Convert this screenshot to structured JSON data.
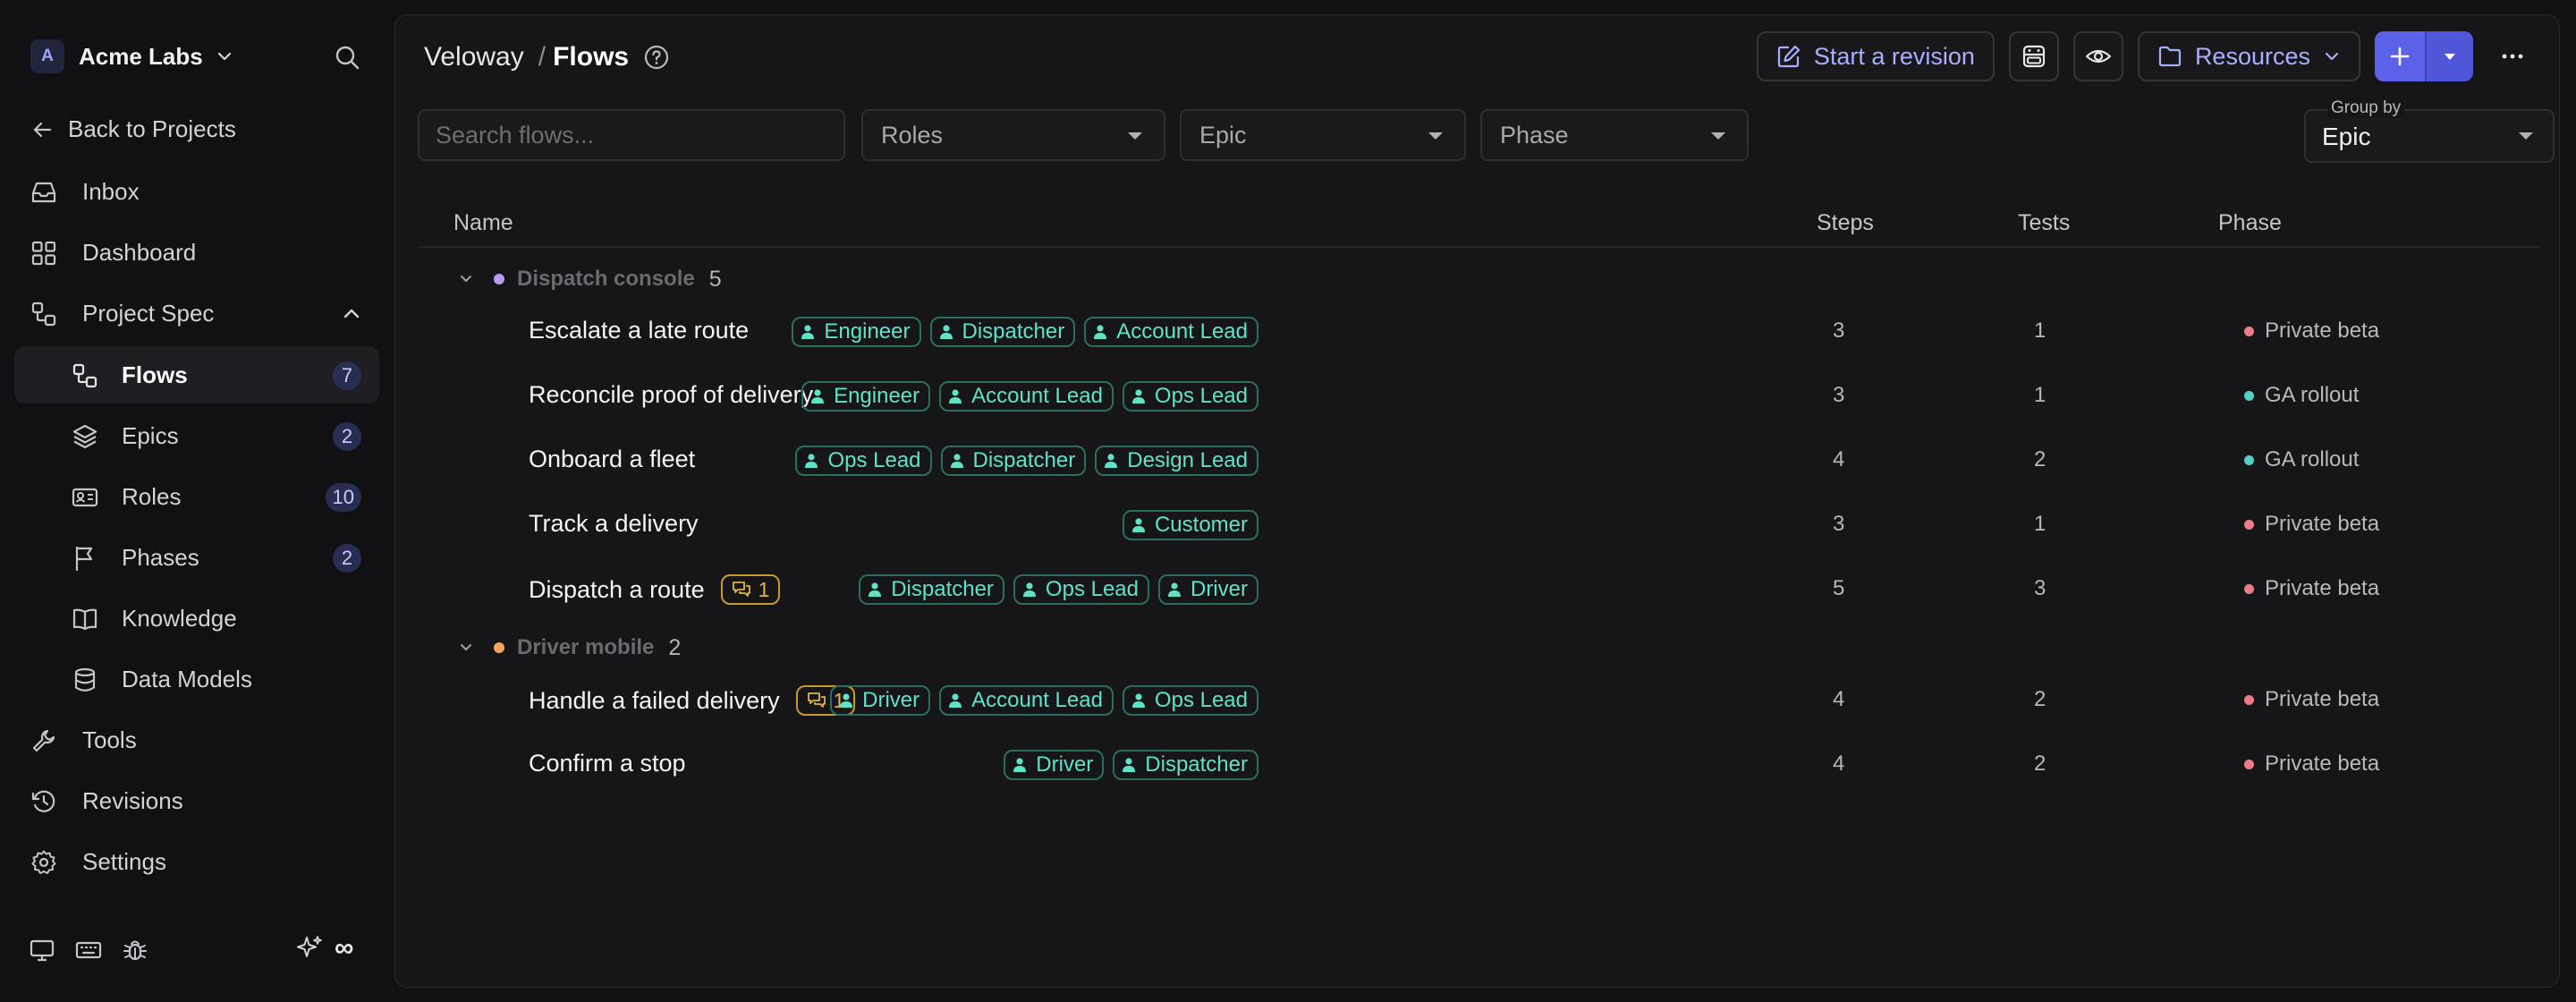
{
  "workspace": {
    "initial": "A",
    "name": "Acme Labs"
  },
  "sidebar": {
    "back": "Back to Projects",
    "items": [
      {
        "label": "Inbox"
      },
      {
        "label": "Dashboard"
      },
      {
        "label": "Project Spec"
      },
      {
        "label": "Flows",
        "count": "7"
      },
      {
        "label": "Epics",
        "count": "2"
      },
      {
        "label": "Roles",
        "count": "10"
      },
      {
        "label": "Phases",
        "count": "2"
      },
      {
        "label": "Knowledge"
      },
      {
        "label": "Data Models"
      },
      {
        "label": "Tools"
      },
      {
        "label": "Revisions"
      },
      {
        "label": "Settings"
      }
    ],
    "footer_infinity": "∞"
  },
  "header": {
    "project": "Veloway",
    "separator": "/",
    "page": "Flows",
    "start_revision": "Start a revision",
    "resources": "Resources"
  },
  "filters": {
    "search_placeholder": "Search flows...",
    "roles": "Roles",
    "epic": "Epic",
    "phase": "Phase",
    "group_by_label": "Group by",
    "group_by_value": "Epic"
  },
  "table": {
    "columns": {
      "name": "Name",
      "steps": "Steps",
      "tests": "Tests",
      "phase": "Phase"
    },
    "groups": [
      {
        "name": "Dispatch console",
        "count": "5",
        "dot_color": "#b79cf2",
        "rows": [
          {
            "name": "Escalate a late route",
            "roles": [
              "Engineer",
              "Dispatcher",
              "Account Lead"
            ],
            "steps": "3",
            "tests": "1",
            "phase": "Private beta",
            "phase_color": "#f27a84"
          },
          {
            "name": "Reconcile proof of delivery",
            "roles": [
              "Engineer",
              "Account Lead",
              "Ops Lead"
            ],
            "steps": "3",
            "tests": "1",
            "phase": "GA rollout",
            "phase_color": "#4fd1c5"
          },
          {
            "name": "Onboard a fleet",
            "roles": [
              "Ops Lead",
              "Dispatcher",
              "Design Lead"
            ],
            "steps": "4",
            "tests": "2",
            "phase": "GA rollout",
            "phase_color": "#4fd1c5"
          },
          {
            "name": "Track a delivery",
            "roles": [
              "Customer"
            ],
            "steps": "3",
            "tests": "1",
            "phase": "Private beta",
            "phase_color": "#f27a84"
          },
          {
            "name": "Dispatch a route",
            "comments": "1",
            "roles": [
              "Dispatcher",
              "Ops Lead",
              "Driver"
            ],
            "steps": "5",
            "tests": "3",
            "phase": "Private beta",
            "phase_color": "#f27a84"
          }
        ]
      },
      {
        "name": "Driver mobile",
        "count": "2",
        "dot_color": "#f2a65a",
        "rows": [
          {
            "name": "Handle a failed delivery",
            "comments": "1",
            "roles": [
              "Driver",
              "Account Lead",
              "Ops Lead"
            ],
            "steps": "4",
            "tests": "2",
            "phase": "Private beta",
            "phase_color": "#f27a84"
          },
          {
            "name": "Confirm a stop",
            "roles": [
              "Driver",
              "Dispatcher"
            ],
            "steps": "4",
            "tests": "2",
            "phase": "Private beta",
            "phase_color": "#f27a84"
          }
        ]
      }
    ]
  },
  "colors": {
    "accent": "#5b62e8",
    "role": "#5fe3c6",
    "comment": "#e2b44a"
  }
}
